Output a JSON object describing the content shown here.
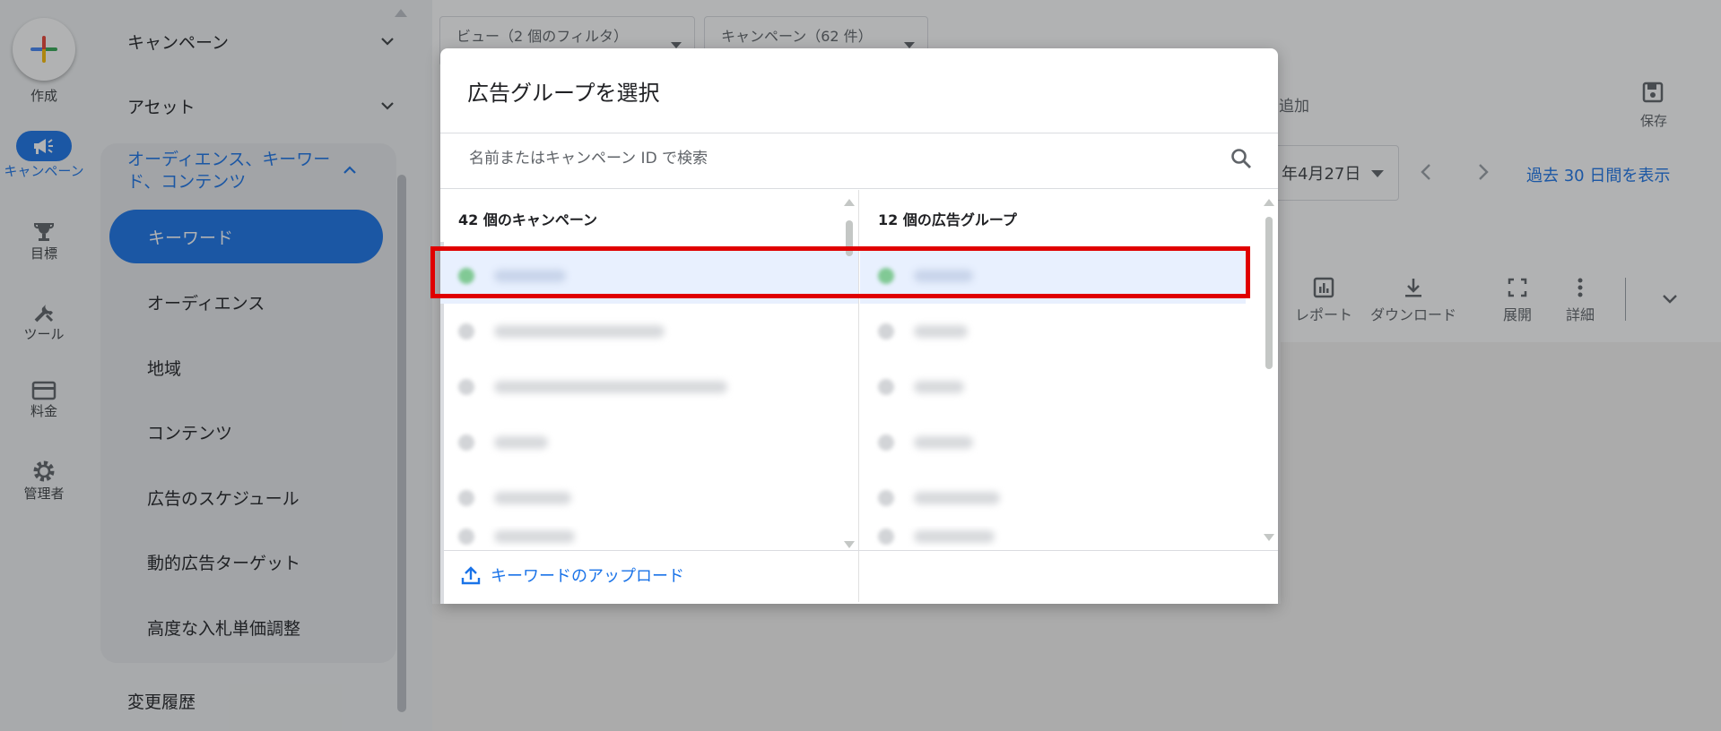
{
  "rail": {
    "create_label": "作成",
    "items": [
      {
        "label": "キャンペーン",
        "icon": "megaphone-icon",
        "active": true
      },
      {
        "label": "目標",
        "icon": "trophy-icon"
      },
      {
        "label": "ツール",
        "icon": "tools-icon"
      },
      {
        "label": "料金",
        "icon": "credit-card-icon"
      },
      {
        "label": "管理者",
        "icon": "gear-icon"
      }
    ]
  },
  "nav": {
    "campaigns": "キャンペーン",
    "assets": "アセット",
    "group_title": "オーディエンス、キーワード、コンテンツ",
    "sub_items": [
      "キーワード",
      "オーディエンス",
      "地域",
      "コンテンツ",
      "広告のスケジュール",
      "動的広告ターゲット",
      "高度な入札単価調整"
    ],
    "change_history": "変更履歴"
  },
  "main": {
    "view_filter": "ビュー（2 個のフィルタ）",
    "campaign_filter": "キャンペーン（62 件）",
    "add_label": "追加",
    "save_label": "保存",
    "date_text": "年4月27日",
    "show_period": "過去 30 日間を表示",
    "toolbar": [
      "レポート",
      "ダウンロード",
      "展開",
      "詳細"
    ]
  },
  "dialog": {
    "title": "広告グループを選択",
    "search_placeholder": "名前またはキャンペーン ID で検索",
    "campaign_count": "42 個のキャンペーン",
    "adgroup_count": "12 個の広告グループ",
    "upload_label": "キーワードのアップロード"
  },
  "colors": {
    "accent": "#1a73e8",
    "highlight": "#e00000",
    "enabled_dot": "#81c995"
  }
}
